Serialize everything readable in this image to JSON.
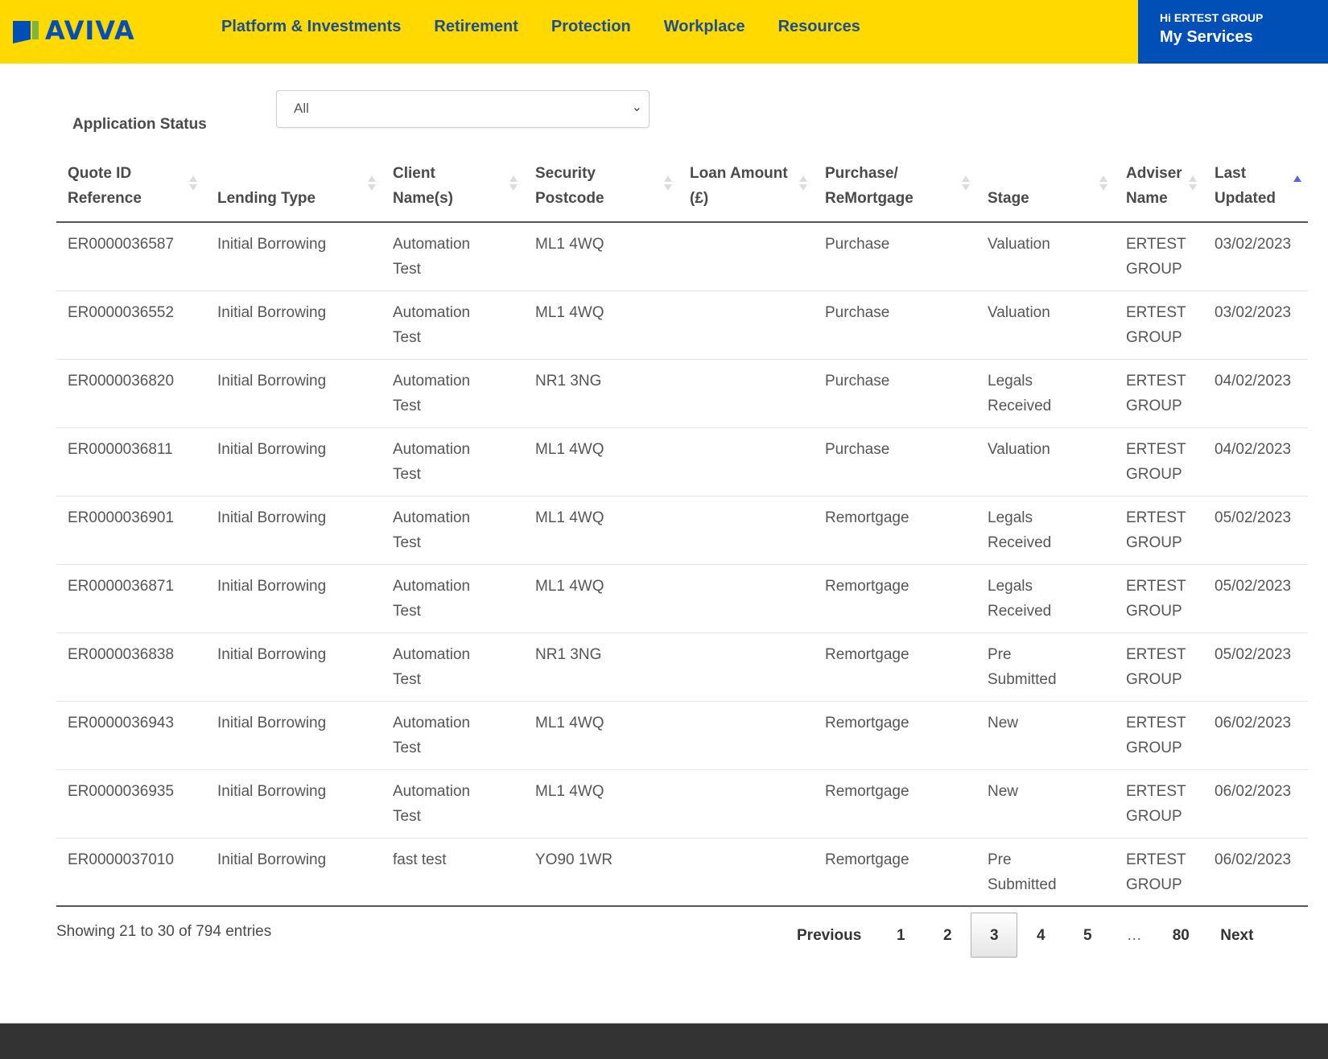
{
  "header": {
    "logo_text": "AVIVA",
    "nav": [
      "Platform & Investments",
      "Retirement",
      "Protection",
      "Workplace",
      "Resources"
    ],
    "greeting": "Hi ERTEST GROUP",
    "services": "My Services",
    "colors": {
      "brand_yellow": "#FFD900",
      "brand_blue": "#004FB6",
      "brand_green": "#7DB540"
    }
  },
  "filter": {
    "label": "Application Status",
    "selected": "All"
  },
  "table": {
    "columns": [
      {
        "line1": "Quote ID",
        "line2": "Reference"
      },
      {
        "line1": "",
        "line2": "Lending Type"
      },
      {
        "line1": "Client",
        "line2": "Name(s)"
      },
      {
        "line1": "Security",
        "line2": "Postcode"
      },
      {
        "line1": "Loan Amount",
        "line2": "(£)"
      },
      {
        "line1": "Purchase/",
        "line2": "ReMortgage"
      },
      {
        "line1": "",
        "line2": "Stage"
      },
      {
        "line1": "Adviser",
        "line2": "Name"
      },
      {
        "line1": "Last",
        "line2": "Updated"
      }
    ],
    "sorted_column": "Last Updated",
    "sort_direction": "ascending",
    "rows": [
      [
        "ER0000036587",
        "Initial Borrowing",
        "Automation Test",
        "ML1 4WQ",
        "",
        "Purchase",
        "Valuation",
        "ERTEST GROUP",
        "03/02/2023"
      ],
      [
        "ER0000036552",
        "Initial Borrowing",
        "Automation Test",
        "ML1 4WQ",
        "",
        "Purchase",
        "Valuation",
        "ERTEST GROUP",
        "03/02/2023"
      ],
      [
        "ER0000036820",
        "Initial Borrowing",
        "Automation Test",
        "NR1 3NG",
        "",
        "Purchase",
        "Legals Received",
        "ERTEST GROUP",
        "04/02/2023"
      ],
      [
        "ER0000036811",
        "Initial Borrowing",
        "Automation Test",
        "ML1 4WQ",
        "",
        "Purchase",
        "Valuation",
        "ERTEST GROUP",
        "04/02/2023"
      ],
      [
        "ER0000036901",
        "Initial Borrowing",
        "Automation Test",
        "ML1 4WQ",
        "",
        "Remortgage",
        "Legals Received",
        "ERTEST GROUP",
        "05/02/2023"
      ],
      [
        "ER0000036871",
        "Initial Borrowing",
        "Automation Test",
        "ML1 4WQ",
        "",
        "Remortgage",
        "Legals Received",
        "ERTEST GROUP",
        "05/02/2023"
      ],
      [
        "ER0000036838",
        "Initial Borrowing",
        "Automation Test",
        "NR1 3NG",
        "",
        "Remortgage",
        "Pre Submitted",
        "ERTEST GROUP",
        "05/02/2023"
      ],
      [
        "ER0000036943",
        "Initial Borrowing",
        "Automation Test",
        "ML1 4WQ",
        "",
        "Remortgage",
        "New",
        "ERTEST GROUP",
        "06/02/2023"
      ],
      [
        "ER0000036935",
        "Initial Borrowing",
        "Automation Test",
        "ML1 4WQ",
        "",
        "Remortgage",
        "New",
        "ERTEST GROUP",
        "06/02/2023"
      ],
      [
        "ER0000037010",
        "Initial Borrowing",
        "fast test",
        "YO90 1WR",
        "",
        "Remortgage",
        "Pre Submitted",
        "ERTEST GROUP",
        "06/02/2023"
      ]
    ]
  },
  "info": "Showing 21 to 30 of 794 entries",
  "pagination": {
    "previous": "Previous",
    "pages": [
      "1",
      "2",
      "3",
      "4",
      "5",
      "…",
      "80"
    ],
    "current": "3",
    "next": "Next"
  }
}
